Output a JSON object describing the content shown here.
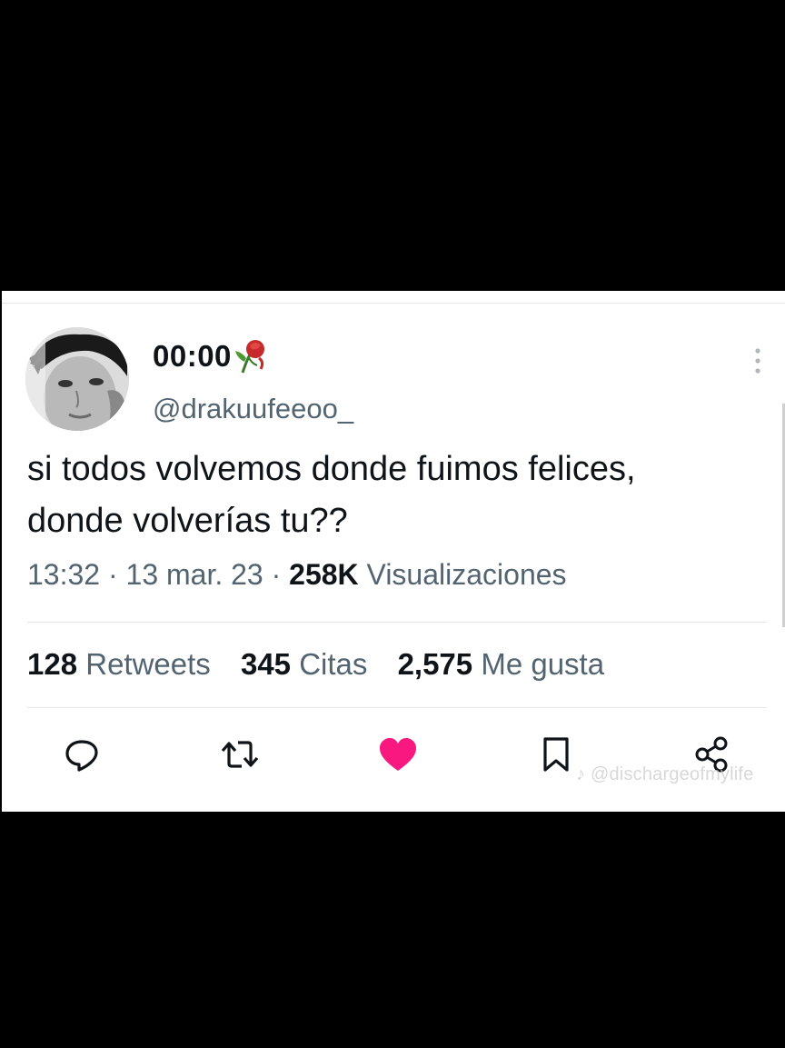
{
  "user": {
    "display_name": "00:00",
    "name_emoji": "wilted-rose-icon",
    "handle": "@drakuufeeoo_"
  },
  "tweet": {
    "line1": "si todos volvemos donde fuimos felices,",
    "line2": "donde volverías tu??"
  },
  "meta": {
    "time": "13:32",
    "sep1": " · ",
    "date": "13 mar. 23",
    "sep2": " · ",
    "views_count": "258K",
    "views_label": "Visualizaciones"
  },
  "stats": {
    "retweets_count": "128",
    "retweets_label": "Retweets",
    "quotes_count": "345",
    "quotes_label": "Citas",
    "likes_count": "2,575",
    "likes_label": "Me gusta"
  },
  "actions": {
    "reply": "reply-icon",
    "retweet": "retweet-icon",
    "like": "heart-icon",
    "like_color": "#f91880",
    "bookmark": "bookmark-icon",
    "share": "share-icon"
  },
  "watermark": "@dischargeofmylife"
}
